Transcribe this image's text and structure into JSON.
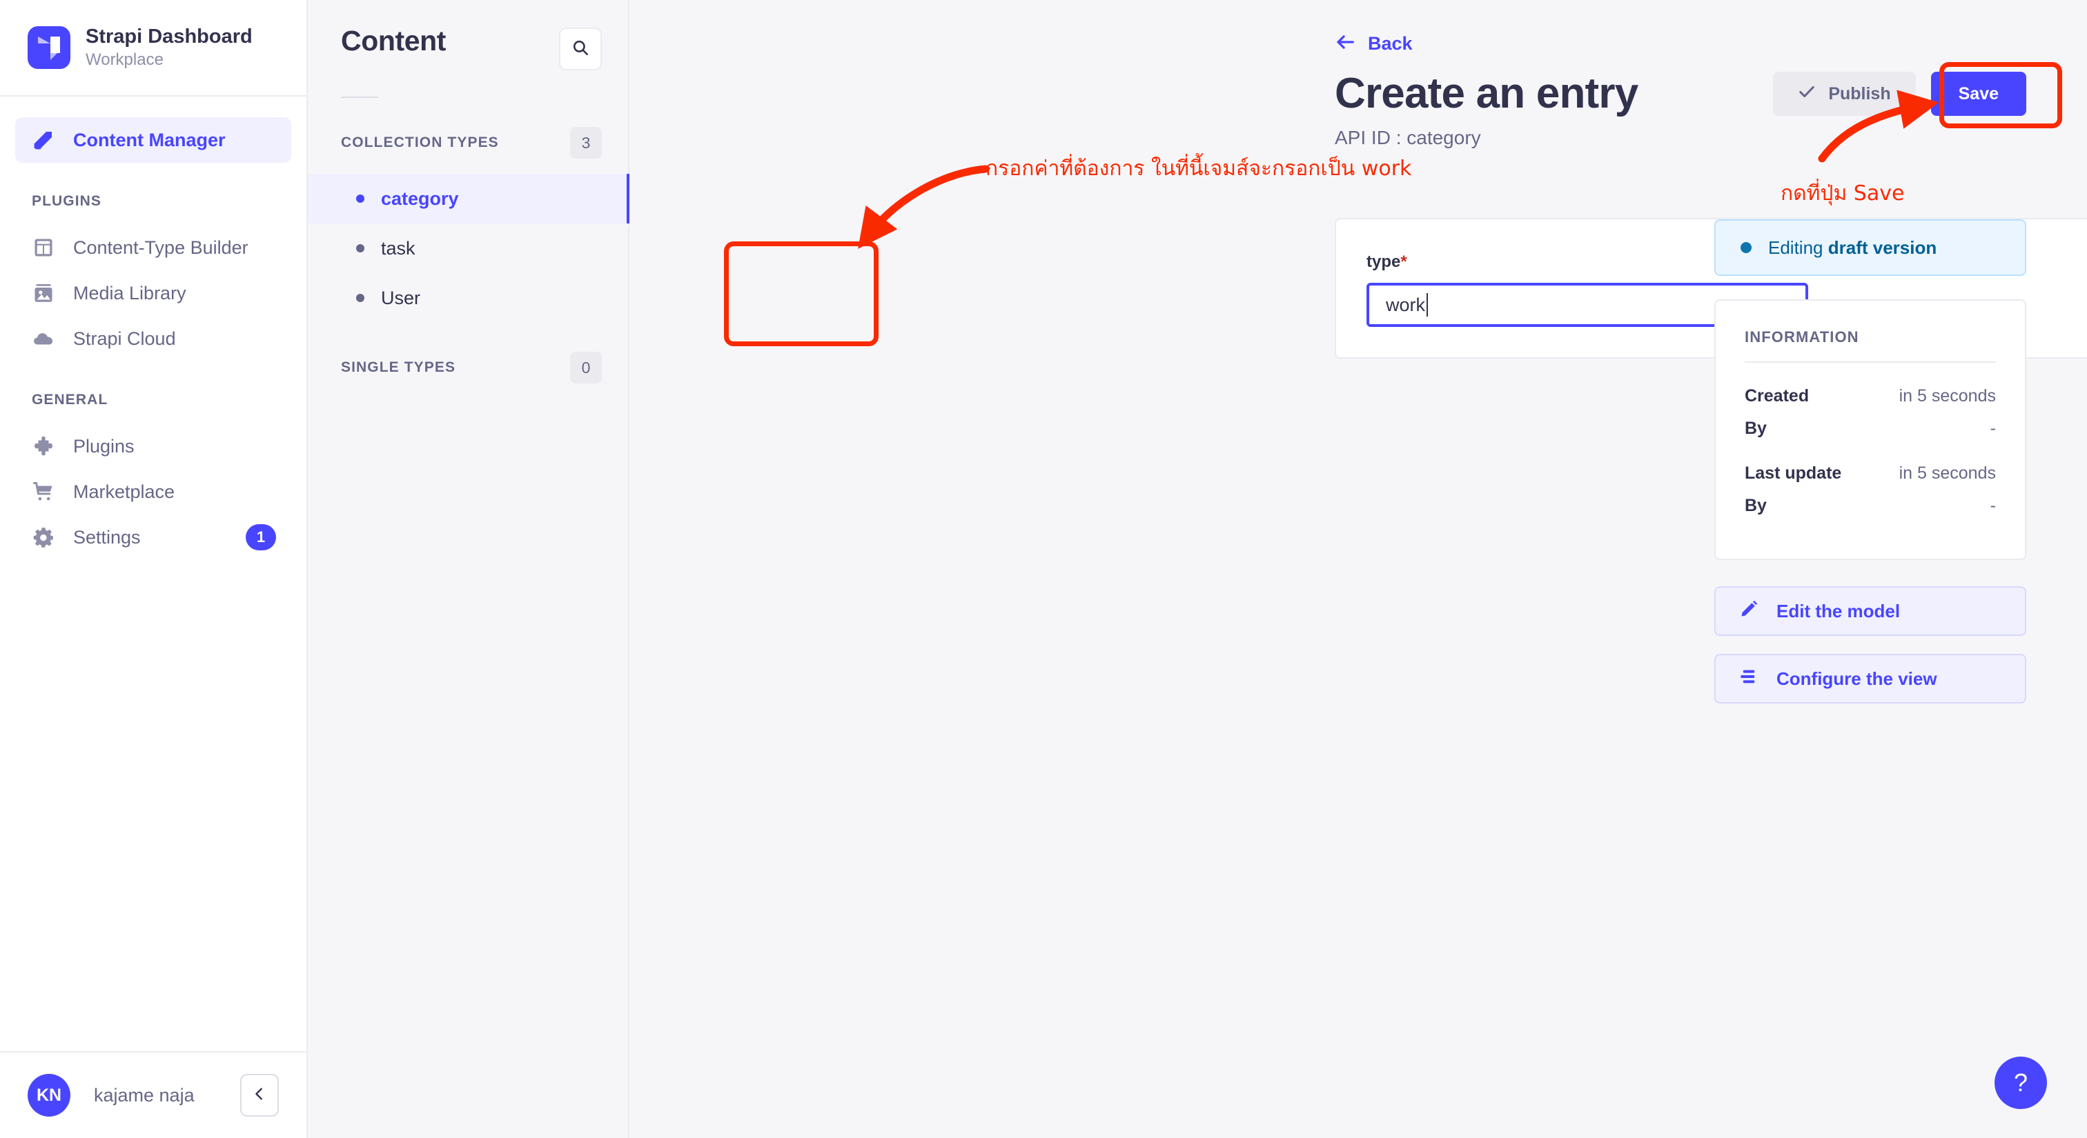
{
  "brand": {
    "title": "Strapi Dashboard",
    "subtitle": "Workplace",
    "logo_icon": "strapi-logo-icon",
    "accent": "#4945ff"
  },
  "sidebar": {
    "primary": [
      {
        "label": "Content Manager",
        "icon": "feather-pen-icon",
        "active": true
      }
    ],
    "sections": [
      {
        "label": "PLUGINS",
        "items": [
          {
            "label": "Content-Type Builder",
            "icon": "layout-grid-icon"
          },
          {
            "label": "Media Library",
            "icon": "image-icon"
          },
          {
            "label": "Strapi Cloud",
            "icon": "cloud-icon"
          }
        ]
      },
      {
        "label": "GENERAL",
        "items": [
          {
            "label": "Plugins",
            "icon": "puzzle-piece-icon"
          },
          {
            "label": "Marketplace",
            "icon": "shopping-cart-icon"
          },
          {
            "label": "Settings",
            "icon": "gear-icon",
            "badge": "1"
          }
        ]
      }
    ],
    "footer": {
      "avatar_initials": "KN",
      "user_name": "kajame naja",
      "collapse_icon": "chevron-left-icon"
    }
  },
  "content_panel": {
    "title": "Content",
    "search_icon": "search-icon",
    "groups": [
      {
        "label": "COLLECTION TYPES",
        "count": "3",
        "items": [
          {
            "label": "category",
            "active": true
          },
          {
            "label": "task",
            "active": false
          },
          {
            "label": "User",
            "active": false
          }
        ]
      },
      {
        "label": "SINGLE TYPES",
        "count": "0",
        "items": []
      }
    ]
  },
  "main": {
    "back_label": "Back",
    "back_icon": "arrow-left-icon",
    "page_title": "Create an entry",
    "api_id_label": "API ID : category",
    "actions": {
      "publish_label": "Publish",
      "publish_icon": "check-icon",
      "save_label": "Save",
      "save_color": "#4945ff"
    },
    "form": {
      "fields": [
        {
          "label": "type",
          "required_marker": "*",
          "value": "work",
          "placeholder": ""
        }
      ]
    }
  },
  "rail": {
    "status": {
      "prefix": "Editing ",
      "emphasis": "draft version",
      "color": "#006096",
      "background": "#eaf5ff"
    },
    "information": {
      "title": "INFORMATION",
      "rows": [
        {
          "key": "Created",
          "value": "in 5 seconds"
        },
        {
          "key": "By",
          "value": "-"
        },
        {
          "key": "Last update",
          "value": "in 5 seconds"
        },
        {
          "key": "By",
          "value": "-"
        }
      ]
    },
    "buttons": [
      {
        "label": "Edit the model",
        "icon": "pencil-icon"
      },
      {
        "label": "Configure the view",
        "icon": "layout-lines-icon"
      }
    ]
  },
  "help": {
    "label": "?",
    "icon": "question-mark-icon"
  },
  "annotations": {
    "color": "#fa2a00",
    "field_note": "กรอกค่าที่ต้องการ ในที่นี้เจมส์จะกรอกเป็น work",
    "save_note": "กดที่ปุ่ม Save"
  }
}
